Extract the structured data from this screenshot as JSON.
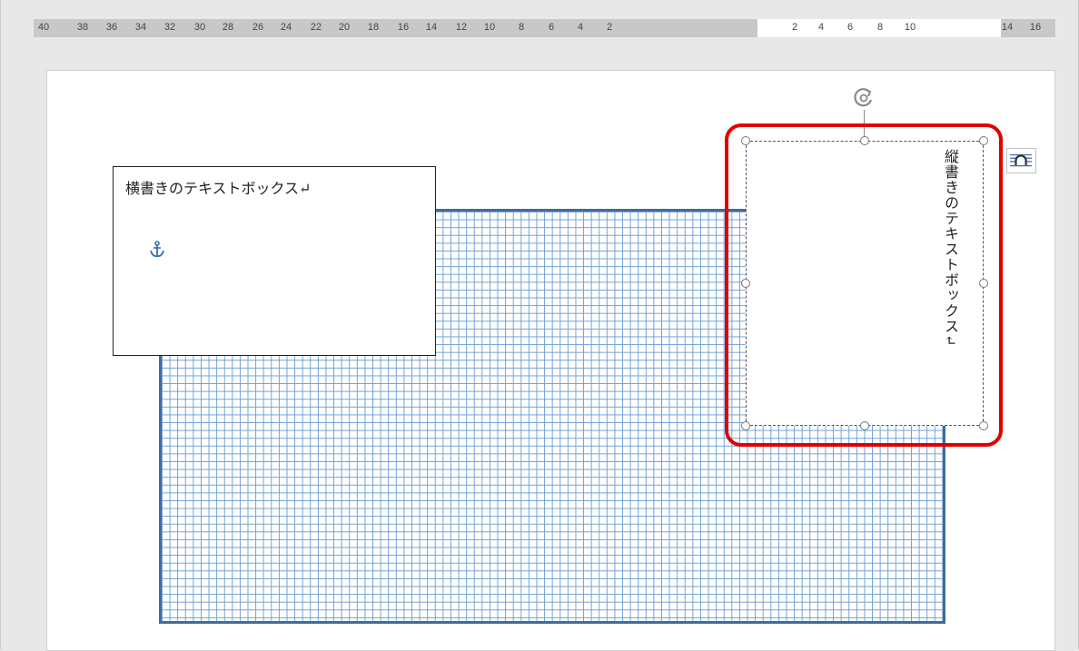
{
  "ruler": {
    "ticks": [
      "40",
      "38",
      "36",
      "34",
      "32",
      "30",
      "28",
      "26",
      "24",
      "22",
      "20",
      "18",
      "16",
      "14",
      "12",
      "10",
      "8",
      "6",
      "4",
      "2",
      "2",
      "4",
      "6",
      "8",
      "10",
      "14",
      "16"
    ]
  },
  "horizontal_textbox": {
    "text": "横書きのテキストボックス↵"
  },
  "vertical_textbox": {
    "text": "縦書きのテキストボックス↵"
  },
  "icons": {
    "anchor": "anchor-icon",
    "rotate": "rotate-handle-icon",
    "layout_options": "layout-options-icon"
  },
  "colors": {
    "highlight": "#e00000",
    "grid_border": "#3e6d9e",
    "grid_lines": "#6e9fd6"
  }
}
